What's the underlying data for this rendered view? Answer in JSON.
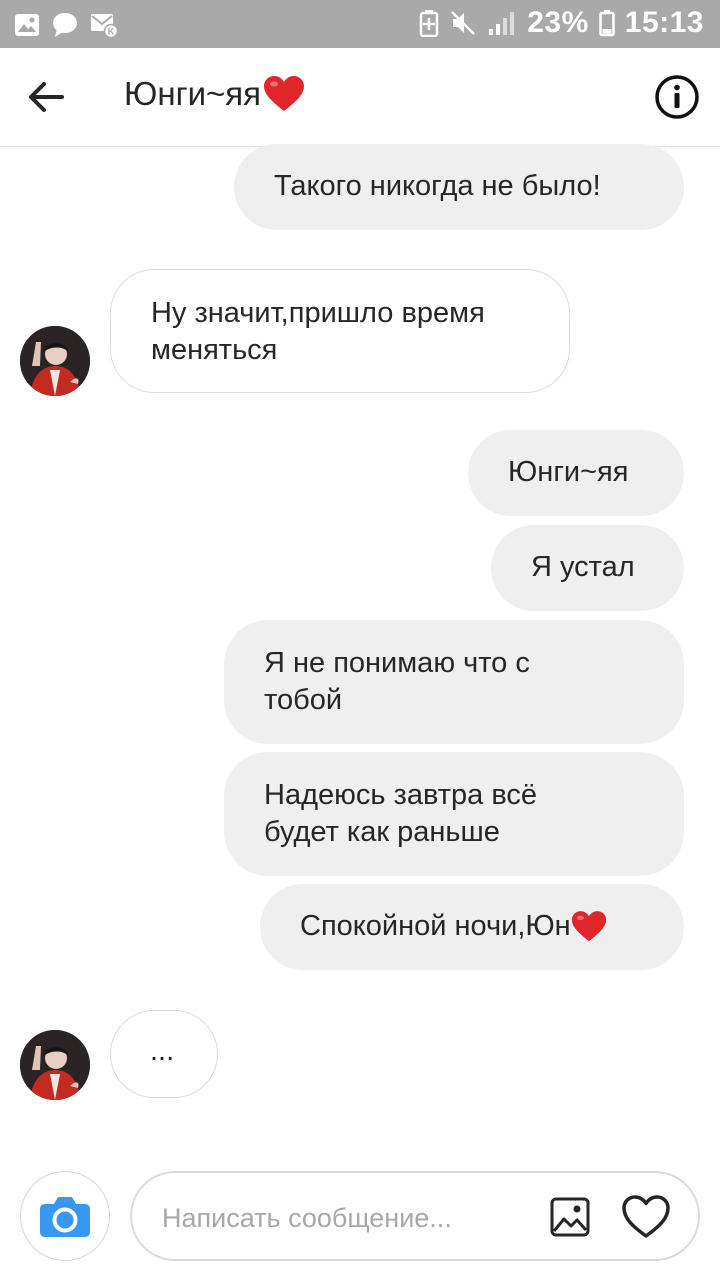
{
  "status_bar": {
    "battery_percent": "23%",
    "time": "15:13",
    "icons_left": [
      "gallery-icon",
      "chat-bubble-icon",
      "vk-mail-icon"
    ],
    "icons_right": [
      "battery-saver-icon",
      "mute-icon",
      "signal-icon",
      "battery-icon"
    ]
  },
  "header": {
    "back_icon": "arrow-left-icon",
    "title": "Юнги~яя",
    "title_emoji": "heart-icon",
    "info_icon": "info-icon"
  },
  "messages": [
    {
      "from": "me",
      "lines": [
        "Такого никогда не было!"
      ]
    },
    {
      "from": "them",
      "lines": [
        "Ну значит,пришло время",
        "меняться"
      ]
    },
    {
      "from": "me",
      "lines": [
        "Юнги~яя"
      ]
    },
    {
      "from": "me",
      "lines": [
        "Я устал"
      ]
    },
    {
      "from": "me",
      "lines": [
        "Я не понимаю что с",
        "тобой"
      ]
    },
    {
      "from": "me",
      "lines": [
        "Надеюсь завтра всё",
        "будет как раньше"
      ]
    },
    {
      "from": "me",
      "lines": [
        "Спокойной ночи,Юн"
      ],
      "emoji": "heart-icon"
    },
    {
      "from": "them",
      "lines": [
        "..."
      ]
    }
  ],
  "composer": {
    "placeholder": "Написать сообщение...",
    "camera_icon": "camera-icon",
    "gallery_icon": "image-icon",
    "like_icon": "heart-outline-icon"
  },
  "colors": {
    "status_bar": "#a9a9a9",
    "my_bubble": "#efefef",
    "their_bubble_border": "#dbdbdb",
    "camera_accent": "#3897f0",
    "heart": "#e0262b"
  }
}
